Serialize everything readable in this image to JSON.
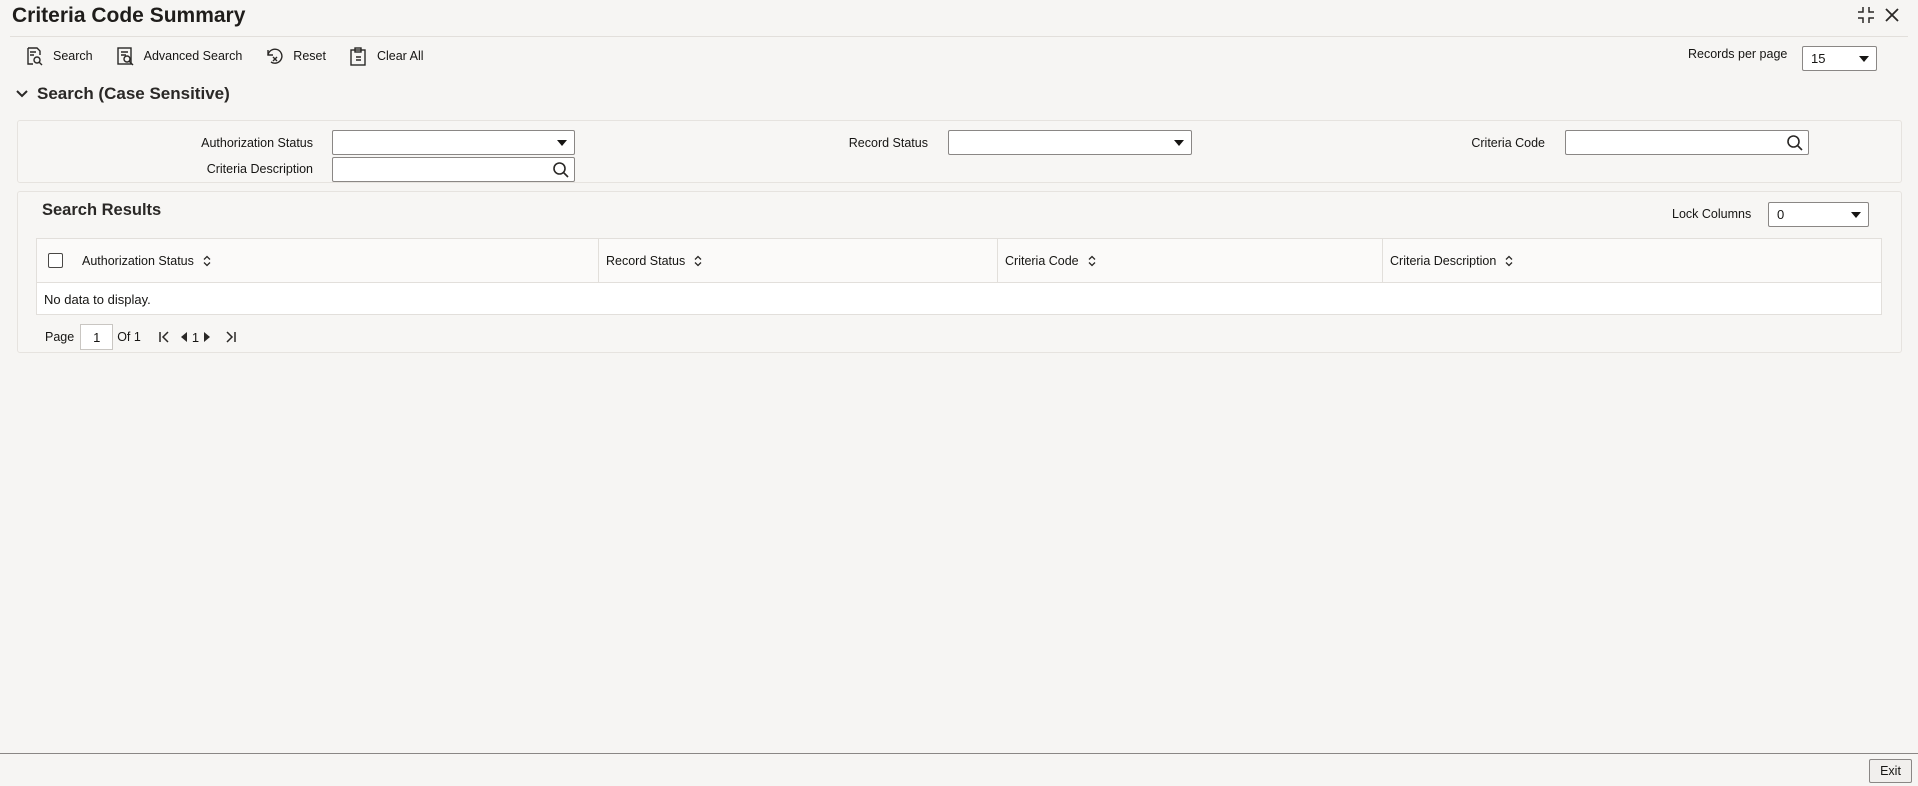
{
  "window": {
    "title": "Criteria Code Summary",
    "controls": [
      "collapse-icon",
      "close-icon"
    ]
  },
  "toolbar": {
    "search_label": "Search",
    "advanced_search_label": "Advanced Search",
    "reset_label": "Reset",
    "clear_all_label": "Clear All",
    "records_per_page_label": "Records per page",
    "records_per_page_value": "15"
  },
  "search_section": {
    "title": "Search (Case Sensitive)",
    "fields": {
      "authorization_status_label": "Authorization Status",
      "authorization_status_value": "",
      "record_status_label": "Record Status",
      "record_status_value": "",
      "criteria_code_label": "Criteria Code",
      "criteria_code_value": "",
      "criteria_description_label": "Criteria Description",
      "criteria_description_value": ""
    }
  },
  "results": {
    "title": "Search Results",
    "lock_columns_label": "Lock Columns",
    "lock_columns_value": "0",
    "columns": [
      "Authorization Status",
      "Record Status",
      "Criteria Code",
      "Criteria Description"
    ],
    "rows": [],
    "empty_message": "No data to display."
  },
  "pager": {
    "page_label": "Page",
    "current_page": "1",
    "of_label": "Of 1",
    "page_number": "1"
  },
  "footer": {
    "exit_label": "Exit"
  },
  "colors": {
    "background": "#f6f5f3",
    "text": "#161513",
    "border": "#8a8785"
  }
}
